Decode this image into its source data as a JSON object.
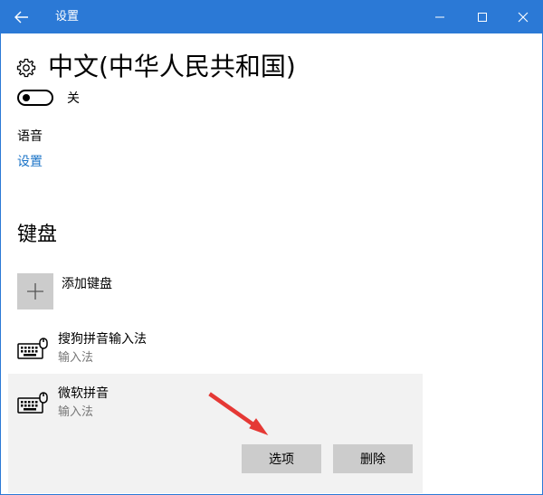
{
  "window": {
    "title": "设置",
    "accent_color": "#2b79d6",
    "controls": {
      "back_icon": "arrow-left-icon",
      "minimize_icon": "minimize-icon",
      "maximize_icon": "maximize-icon",
      "close_icon": "close-icon"
    }
  },
  "page": {
    "title": "中文(中华人民共和国)",
    "title_icon": "gear-icon",
    "toggle": {
      "label": "关",
      "state": "off"
    }
  },
  "language": {
    "label": "语音",
    "link": "设置",
    "link_color": "#1a73c7"
  },
  "keyboards": {
    "heading": "键盘",
    "add_label": "添加键盘",
    "add_icon": "plus-icon",
    "items": [
      {
        "name": "搜狗拼音输入法",
        "type": "输入法",
        "icon": "keyboard-icon",
        "selected": false
      },
      {
        "name": "微软拼音",
        "type": "输入法",
        "icon": "keyboard-icon",
        "selected": true
      }
    ],
    "actions": {
      "options_label": "选项",
      "delete_label": "删除"
    }
  },
  "annotation": {
    "icon": "red-arrow-icon",
    "color": "#e53935"
  }
}
